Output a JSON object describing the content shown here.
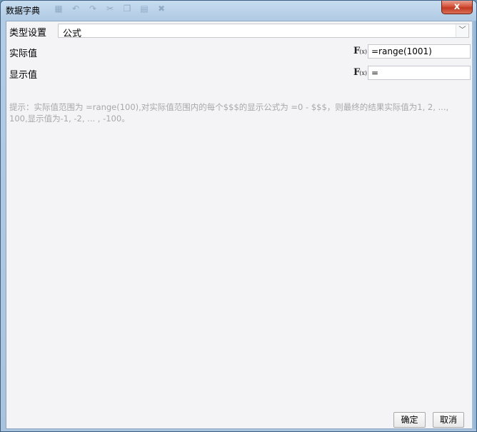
{
  "window": {
    "title": "数据字典",
    "close_label": "x"
  },
  "form": {
    "type_label": "类型设置",
    "type_value": "公式",
    "actual_label": "实际值",
    "actual_value": "=range(1001)",
    "display_label": "显示值",
    "display_value": "=",
    "fx_label": "F",
    "fx_sub": "(x)"
  },
  "hint": {
    "text": "提示：实际值范围为 =range(100),对实际值范围内的每个$$$的显示公式为 =0 - $$$，则最终的结果实际值为1, 2, ..., 100,显示值为-1, -2, ... , -100。"
  },
  "buttons": {
    "ok_label": "确定",
    "cancel_label": "取消"
  }
}
